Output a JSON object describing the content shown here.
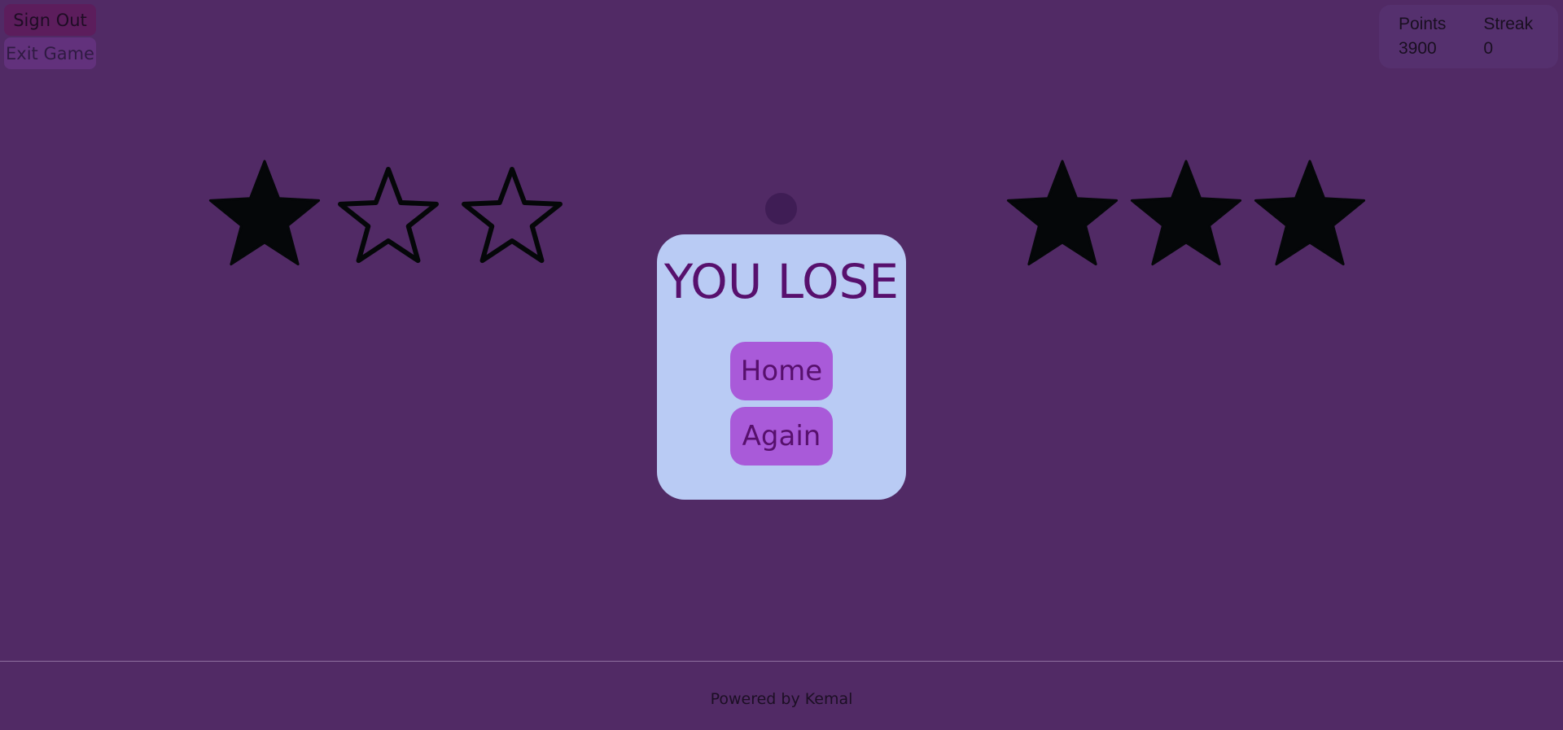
{
  "header": {
    "sign_out_label": "Sign Out",
    "exit_game_label": "Exit Game"
  },
  "scoreboard": {
    "points_label": "Points",
    "points_value": "3900",
    "streak_label": "Streak",
    "streak_value": "0"
  },
  "player_stars": {
    "filled": 1,
    "total": 3
  },
  "opponent_stars": {
    "filled": 3,
    "total": 3
  },
  "result": {
    "title": "YOU LOSE",
    "home_label": "Home",
    "again_label": "Again"
  },
  "footer": {
    "text": "Powered by Kemal"
  },
  "colors": {
    "background": "#512a65",
    "card": "#b9cbf4",
    "accent": "#a95ad9",
    "title_text": "#57106d",
    "star": "#050709"
  }
}
